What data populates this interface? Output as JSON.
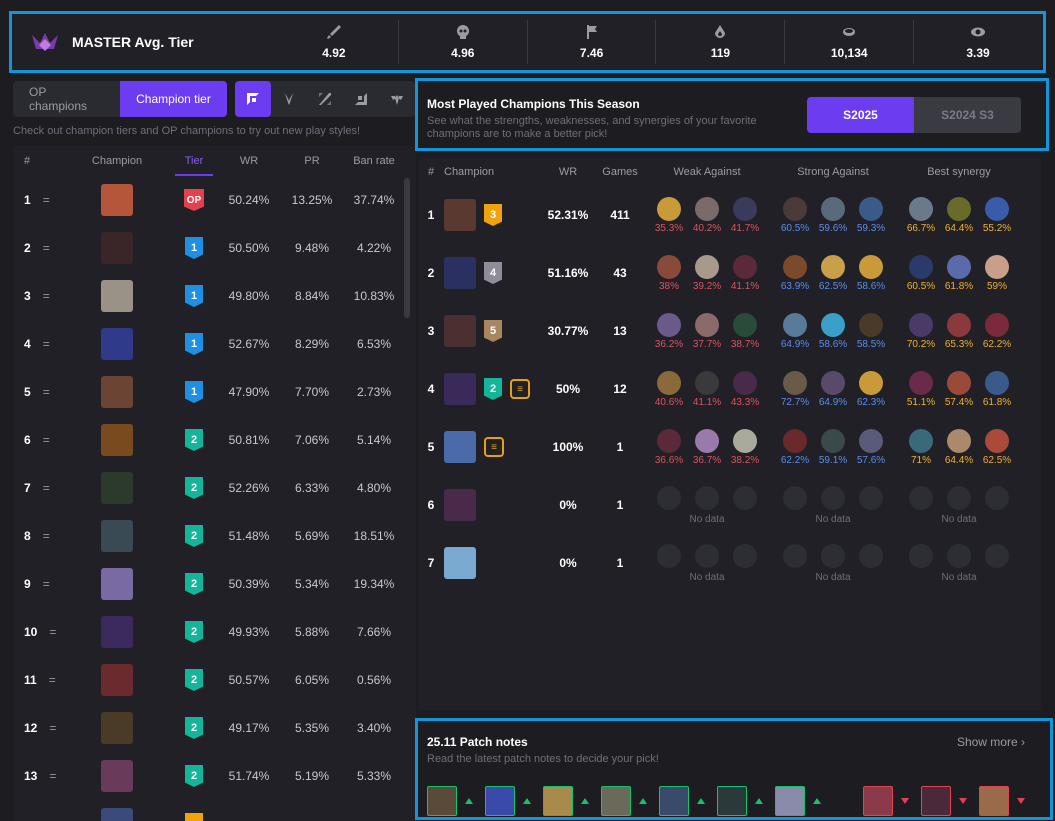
{
  "header": {
    "tier_title": "MASTER Avg. Tier",
    "stats": [
      {
        "icon": "sword-icon",
        "value": "4.92"
      },
      {
        "icon": "skull-icon",
        "value": "4.96"
      },
      {
        "icon": "flag-icon",
        "value": "7.46"
      },
      {
        "icon": "drop-icon",
        "value": "119"
      },
      {
        "icon": "coin-icon",
        "value": "10,134"
      },
      {
        "icon": "eye-icon",
        "value": "3.39"
      }
    ]
  },
  "toggle": {
    "op_label": "OP champions",
    "tier_label": "Champion tier"
  },
  "roles": [
    "top",
    "jungle",
    "mid",
    "adc",
    "support"
  ],
  "hint": "Check out champion tiers and OP champions to try out new play styles!",
  "tierlist": {
    "headers": {
      "rank": "#",
      "champion": "Champion",
      "tier": "Tier",
      "wr": "WR",
      "pr": "PR",
      "ban": "Ban rate"
    },
    "rows": [
      {
        "rank": "1",
        "trend": "=",
        "tier": "OP",
        "tier_class": "op",
        "wr": "50.24%",
        "pr": "13.25%",
        "ban": "37.74%",
        "color": "#b5553a"
      },
      {
        "rank": "2",
        "trend": "=",
        "tier": "1",
        "tier_class": "t1",
        "wr": "50.50%",
        "pr": "9.48%",
        "ban": "4.22%",
        "color": "#3a2528"
      },
      {
        "rank": "3",
        "trend": "=",
        "tier": "1",
        "tier_class": "t1",
        "wr": "49.80%",
        "pr": "8.84%",
        "ban": "10.83%",
        "color": "#9a9286"
      },
      {
        "rank": "4",
        "trend": "=",
        "tier": "1",
        "tier_class": "t1",
        "wr": "52.67%",
        "pr": "8.29%",
        "ban": "6.53%",
        "color": "#2f3a8a"
      },
      {
        "rank": "5",
        "trend": "=",
        "tier": "1",
        "tier_class": "t1",
        "wr": "47.90%",
        "pr": "7.70%",
        "ban": "2.73%",
        "color": "#6b4434"
      },
      {
        "rank": "6",
        "trend": "=",
        "tier": "2",
        "tier_class": "t2",
        "wr": "50.81%",
        "pr": "7.06%",
        "ban": "5.14%",
        "color": "#7a4a1f"
      },
      {
        "rank": "7",
        "trend": "=",
        "tier": "2",
        "tier_class": "t2",
        "wr": "52.26%",
        "pr": "6.33%",
        "ban": "4.80%",
        "color": "#2b3a2a"
      },
      {
        "rank": "8",
        "trend": "=",
        "tier": "2",
        "tier_class": "t2",
        "wr": "51.48%",
        "pr": "5.69%",
        "ban": "18.51%",
        "color": "#3a4a52"
      },
      {
        "rank": "9",
        "trend": "=",
        "tier": "2",
        "tier_class": "t2",
        "wr": "50.39%",
        "pr": "5.34%",
        "ban": "19.34%",
        "color": "#7a6aa4"
      },
      {
        "rank": "10",
        "trend": "=",
        "tier": "2",
        "tier_class": "t2",
        "wr": "49.93%",
        "pr": "5.88%",
        "ban": "7.66%",
        "color": "#3b2a5e"
      },
      {
        "rank": "11",
        "trend": "=",
        "tier": "2",
        "tier_class": "t2",
        "wr": "50.57%",
        "pr": "6.05%",
        "ban": "0.56%",
        "color": "#6a2a2e"
      },
      {
        "rank": "12",
        "trend": "=",
        "tier": "2",
        "tier_class": "t2",
        "wr": "49.17%",
        "pr": "5.35%",
        "ban": "3.40%",
        "color": "#4a3a28"
      },
      {
        "rank": "13",
        "trend": "=",
        "tier": "2",
        "tier_class": "t2",
        "wr": "51.74%",
        "pr": "5.19%",
        "ban": "5.33%",
        "color": "#6a3a5a"
      },
      {
        "rank": "",
        "trend": "",
        "tier": "",
        "tier_class": "t3",
        "wr": "",
        "pr": "",
        "ban": "",
        "color": "#3a4a7a"
      }
    ]
  },
  "most_played": {
    "title": "Most Played Champions This Season",
    "subtitle": "See what the strengths, weaknesses, and synergies of your favorite champions are to make a better pick!",
    "season_active": "S2025",
    "season_other": "S2024 S3",
    "headers": {
      "rank": "#",
      "champion": "Champion",
      "wr": "WR",
      "games": "Games",
      "weak": "Weak Against",
      "strong": "Strong Against",
      "syn": "Best synergy"
    },
    "no_data": "No data",
    "rows": [
      {
        "rank": "1",
        "badge": "3",
        "badge_class": "t3",
        "coin": false,
        "wr": "52.31%",
        "games": "411",
        "color": "#5a3a30",
        "weak": [
          [
            "35.3%",
            "#c89a3a"
          ],
          [
            "40.2%",
            "#7a6a6a"
          ],
          [
            "41.7%",
            "#3a3a5a"
          ]
        ],
        "strong": [
          [
            "60.5%",
            "#4a3a3a"
          ],
          [
            "59.6%",
            "#5a6a7a"
          ],
          [
            "59.3%",
            "#3a5a8a"
          ]
        ],
        "syn": [
          [
            "66.7%",
            "#6a7a8a"
          ],
          [
            "64.4%",
            "#6a6a2a"
          ],
          [
            "55.2%",
            "#3a5aaa"
          ]
        ]
      },
      {
        "rank": "2",
        "badge": "4",
        "badge_class": "t4",
        "coin": false,
        "wr": "51.16%",
        "games": "43",
        "color": "#2a3060",
        "weak": [
          [
            "38%",
            "#8a4a3a"
          ],
          [
            "39.2%",
            "#a89a8a"
          ],
          [
            "41.1%",
            "#5a2a3a"
          ]
        ],
        "strong": [
          [
            "63.9%",
            "#7a4a2a"
          ],
          [
            "62.5%",
            "#c8a04a"
          ],
          [
            "58.6%",
            "#c89a3a"
          ]
        ],
        "syn": [
          [
            "60.5%",
            "#2a3a6a"
          ],
          [
            "61.8%",
            "#5a6aaa"
          ],
          [
            "59%",
            "#c8a08a"
          ]
        ]
      },
      {
        "rank": "3",
        "badge": "5",
        "badge_class": "t5",
        "coin": false,
        "wr": "30.77%",
        "games": "13",
        "color": "#4a3030",
        "weak": [
          [
            "36.2%",
            "#6a5a8a"
          ],
          [
            "37.7%",
            "#8a6a6a"
          ],
          [
            "38.7%",
            "#2a4a3a"
          ]
        ],
        "strong": [
          [
            "64.9%",
            "#5a7a9a"
          ],
          [
            "58.6%",
            "#3aa0c8"
          ],
          [
            "58.5%",
            "#4a3a2a"
          ]
        ],
        "syn": [
          [
            "70.2%",
            "#4a3a6a"
          ],
          [
            "65.3%",
            "#8a3a3a"
          ],
          [
            "62.2%",
            "#7a2a3a"
          ]
        ]
      },
      {
        "rank": "4",
        "badge": "2",
        "badge_class": "t2",
        "coin": true,
        "wr": "50%",
        "games": "12",
        "color": "#3a2a5a",
        "weak": [
          [
            "40.6%",
            "#8a6a3a"
          ],
          [
            "41.1%",
            "#3a3a3a"
          ],
          [
            "43.3%",
            "#4a2a4a"
          ]
        ],
        "strong": [
          [
            "72.7%",
            "#6a5a4a"
          ],
          [
            "64.9%",
            "#5a4a6a"
          ],
          [
            "62.3%",
            "#c89a3a"
          ]
        ],
        "syn": [
          [
            "51.1%",
            "#6a2a4a"
          ],
          [
            "57.4%",
            "#9a4a3a"
          ],
          [
            "61.8%",
            "#3a5a8a"
          ]
        ]
      },
      {
        "rank": "5",
        "badge": "",
        "badge_class": "",
        "coin": true,
        "wr": "100%",
        "games": "1",
        "color": "#4a6aaa",
        "weak": [
          [
            "36.6%",
            "#5a2a3a"
          ],
          [
            "36.7%",
            "#9a7aaa"
          ],
          [
            "38.2%",
            "#aaaa9a"
          ]
        ],
        "strong": [
          [
            "62.2%",
            "#6a2a2a"
          ],
          [
            "59.1%",
            "#3a4a4a"
          ],
          [
            "57.6%",
            "#5a5a7a"
          ]
        ],
        "syn": [
          [
            "71%",
            "#3a6a7a"
          ],
          [
            "64.4%",
            "#aa8a6a"
          ],
          [
            "62.5%",
            "#aa4a3a"
          ]
        ]
      },
      {
        "rank": "6",
        "badge": "",
        "badge_class": "",
        "coin": false,
        "wr": "0%",
        "games": "1",
        "color": "#4a2a4a",
        "nodata": true
      },
      {
        "rank": "7",
        "badge": "",
        "badge_class": "",
        "coin": false,
        "wr": "0%",
        "games": "1",
        "color": "#7aaad0",
        "nodata": true
      }
    ]
  },
  "patch": {
    "title": "25.11 Patch notes",
    "subtitle": "Read the latest patch notes to decide your pick!",
    "show_more": "Show more",
    "icons": [
      {
        "color": "#5a4a3a",
        "dir": "up"
      },
      {
        "color": "#3a4aaa",
        "dir": "up"
      },
      {
        "color": "#aa8a4a",
        "dir": "up"
      },
      {
        "color": "#6a6a5a",
        "dir": "up"
      },
      {
        "color": "#3a4a6a",
        "dir": "up"
      },
      {
        "color": "#2a3a3a",
        "dir": "up"
      },
      {
        "color": "#8a8aaa",
        "dir": "up"
      },
      {
        "color": "#8a3a4a",
        "dir": "down"
      },
      {
        "color": "#4a2a3a",
        "dir": "down"
      },
      {
        "color": "#9a6a4a",
        "dir": "down"
      }
    ]
  },
  "colors": {
    "accent": "#6c3cf0",
    "highlight": "#1296db",
    "weak": "#e0525f",
    "strong": "#5b8def",
    "syn": "#f0b030"
  }
}
